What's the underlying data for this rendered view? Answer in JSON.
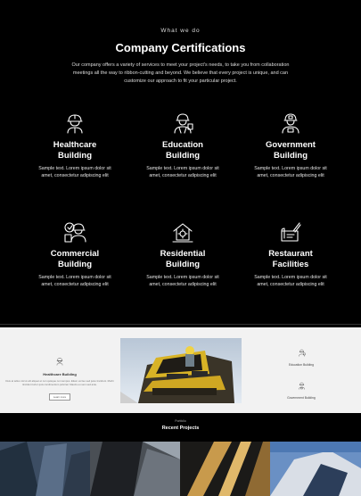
{
  "services": {
    "eyebrow": "What we do",
    "title": "Company Certifications",
    "intro": "Our company offers a variety of services to meet your project's needs, to take you from collaboration meetings all the way to ribbon-cutting and beyond. We believe that every project is unique, and can customize our approach to fit your particular project.",
    "items": [
      {
        "name": "Healthcare\nBuilding",
        "desc": "Sample text. Lorem ipsum dolor sit\namet, consectetur adipiscing elit",
        "icon": "worker-helmet-icon"
      },
      {
        "name": "Education\nBuilding",
        "desc": "Sample text. Lorem ipsum dolor sit\namet, consectetur adipiscing elit",
        "icon": "worker-vest-icon"
      },
      {
        "name": "Government\nBuilding",
        "desc": "Sample text. Lorem ipsum dolor sit\namet, consectetur adipiscing elit",
        "icon": "worker-badge-icon"
      },
      {
        "name": "Commercial\nBuilding",
        "desc": "Sample text. Lorem ipsum dolor sit\namet, consectetur adipiscing elit",
        "icon": "worker-plans-icon"
      },
      {
        "name": "Residential\nBuilding",
        "desc": "Sample text. Lorem ipsum dolor sit\namet, consectetur adipiscing elit",
        "icon": "house-gear-icon"
      },
      {
        "name": "Restaurant\nFacilities",
        "desc": "Sample text. Lorem ipsum dolor sit\namet, consectetur adipiscing elit",
        "icon": "blueprint-pencil-icon"
      }
    ]
  },
  "feature": {
    "left_title": "Healthcare Building",
    "left_desc": "Duis at tellus nisl ut elit aliquet et non quisque non tempus. Etiam vel leo sed justo tincidunt. Morbi tincidunt tortor quis condimentum pulvinar. Mauris eu sem sed ante.",
    "left_button": "Learn more",
    "right_items": [
      {
        "label": "Education Building",
        "icon": "worker-vest-icon"
      },
      {
        "label": "Government Building",
        "icon": "worker-badge-icon"
      }
    ]
  },
  "recent": {
    "eyebrow": "Portfolio",
    "title": "Recent Projects"
  }
}
